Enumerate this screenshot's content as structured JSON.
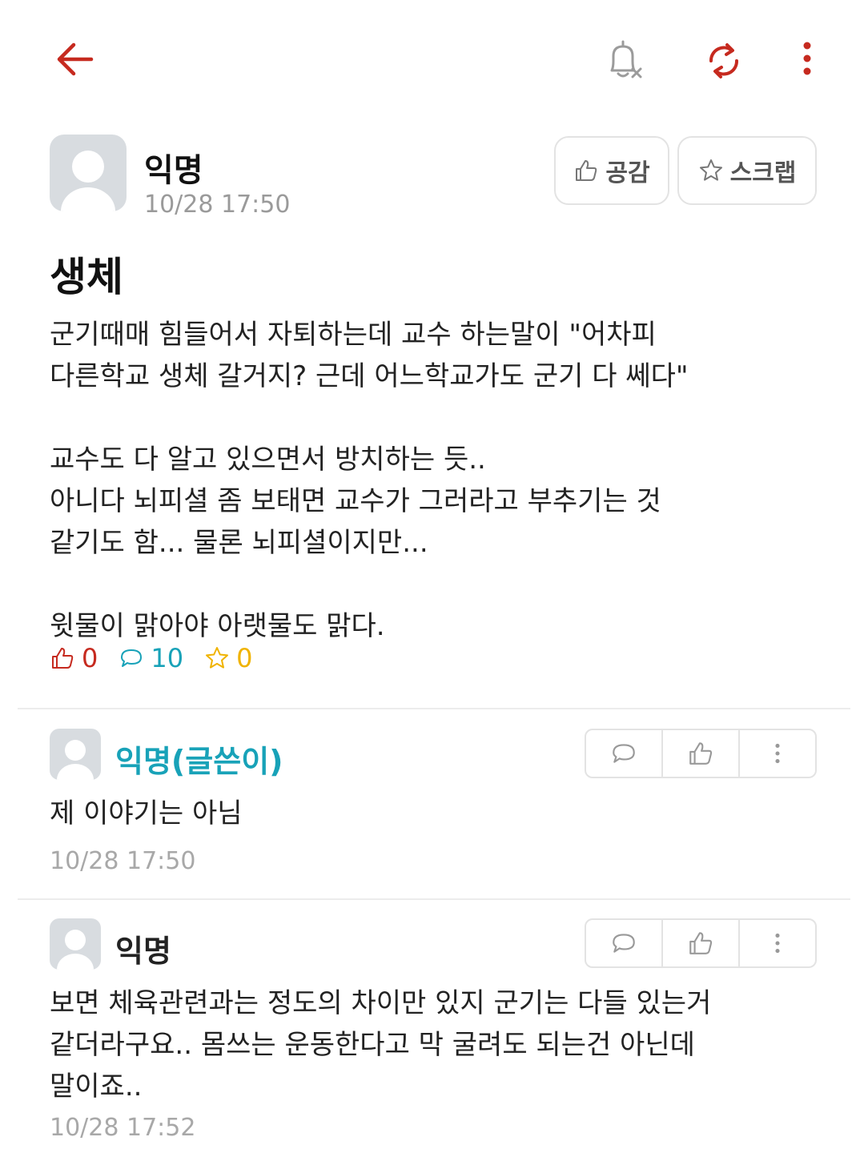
{
  "topbar": {
    "back_icon": "arrow-left-icon",
    "notify_icon": "bell-off-icon",
    "refresh_icon": "refresh-icon",
    "more_icon": "more-vertical-icon",
    "accent_color": "#c62a1f"
  },
  "post": {
    "author": "익명",
    "time": "10/28 17:50",
    "like_button": "공감",
    "scrap_button": "스크랩",
    "title": "생체",
    "body_lines": [
      "군기때매 힘들어서 자퇴하는데 교수 하는말이 \"어차피",
      "다른학교 생체 갈거지? 근데 어느학교가도 군기 다 쎄다\"",
      "",
      "교수도 다 알고 있으면서 방치하는 듯..",
      "아니다 뇌피셜 좀 보태면 교수가 그러라고 부추기는 것",
      "같기도 함... 물론 뇌피셜이지만...",
      "",
      "윗물이 맑아야 아랫물도 맑다."
    ],
    "stats": {
      "likes": "0",
      "comments": "10",
      "scraps": "0",
      "like_color": "#c62a1f",
      "comment_color": "#18a2b8",
      "scrap_color": "#f0b300"
    }
  },
  "comments": [
    {
      "author": "익명(글쓴이)",
      "is_op": true,
      "lines": [
        "제 이야기는 아님"
      ],
      "time": "10/28 17:50"
    },
    {
      "author": "익명",
      "is_op": false,
      "lines": [
        "보면 체육관련과는 정도의 차이만 있지 군기는 다들 있는거",
        "같더라구요.. 몸쓰는 운동한다고 막 굴려도 되는건 아닌데",
        "말이죠.."
      ],
      "time": "10/28 17:52"
    }
  ]
}
